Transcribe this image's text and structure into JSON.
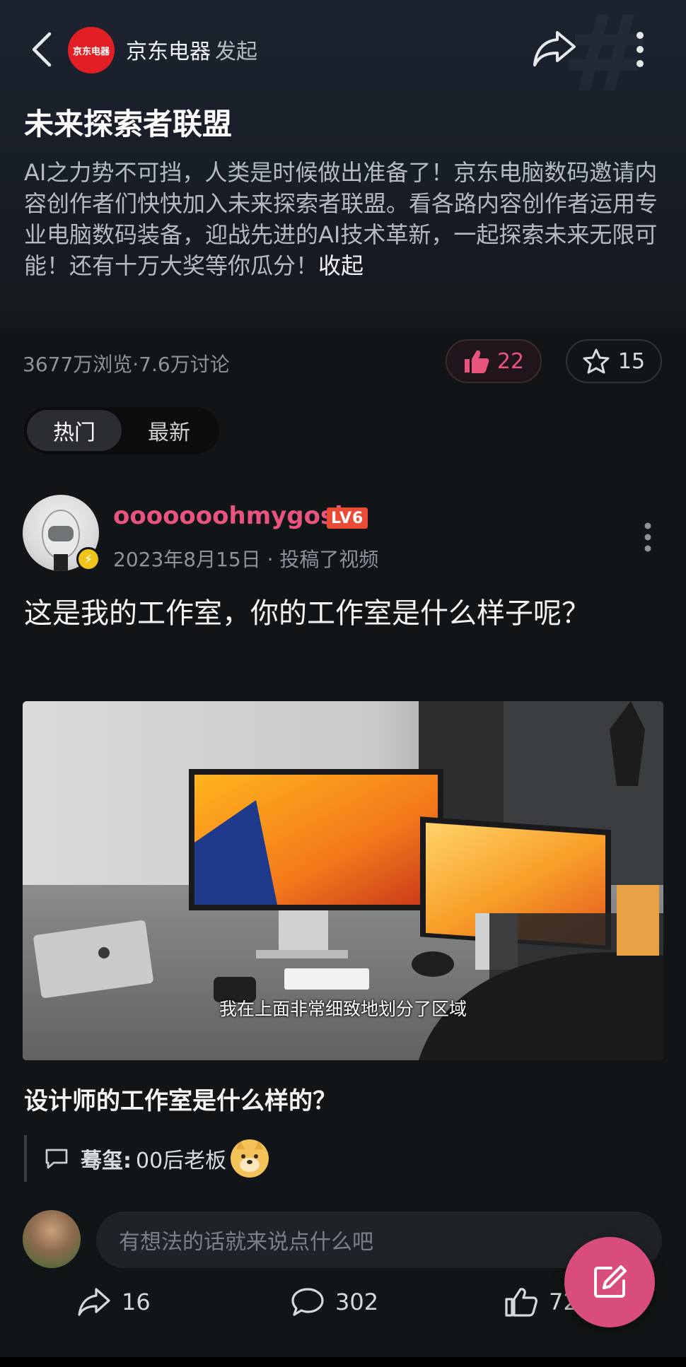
{
  "header": {
    "brand_logo_text": "京东电器",
    "brand_name": "京东电器",
    "brand_action": "发起"
  },
  "topic": {
    "title": "未来探索者联盟",
    "description": "AI之力势不可挡，人类是时候做出准备了！京东电脑数码邀请内容创作者们快快加入未来探索者联盟。看各路内容创作者运用专业电脑数码装备，迎战先进的AI技术革新，一起探索未来无限可能！还有十万大奖等你瓜分！",
    "collapse_label": "收起",
    "stats": "3677万浏览·7.6万讨论",
    "like_count": "22",
    "favorite_count": "15"
  },
  "tabs": [
    {
      "label": "热门",
      "active": true
    },
    {
      "label": "最新",
      "active": false
    }
  ],
  "post": {
    "username": "ooooooohmygosh",
    "level": "LV6",
    "date": "2023年8月15日",
    "meta_action": "· 投稿了视频",
    "text": "这是我的工作室，你的工作室是什么样子呢？",
    "video_subtitle": "我在上面非常细致地划分了区域",
    "video_title": "设计师的工作室是什么样的？",
    "top_comment": {
      "author": "蓦玺:",
      "text": "00后老板"
    },
    "comment_placeholder": "有想法的话就来说点什么吧",
    "share_count": "16",
    "comment_count": "302",
    "like_count": "7213"
  },
  "colors": {
    "accent_pink": "#e8547d",
    "fab_pink": "#d94d7d",
    "brand_red": "#e21f25",
    "level_badge": "#e94b35",
    "background": "#121517"
  },
  "icons": [
    "back-icon",
    "share-icon",
    "more-icon",
    "thumbs-up-icon",
    "star-icon",
    "lightning-icon",
    "comment-icon",
    "edit-icon"
  ]
}
